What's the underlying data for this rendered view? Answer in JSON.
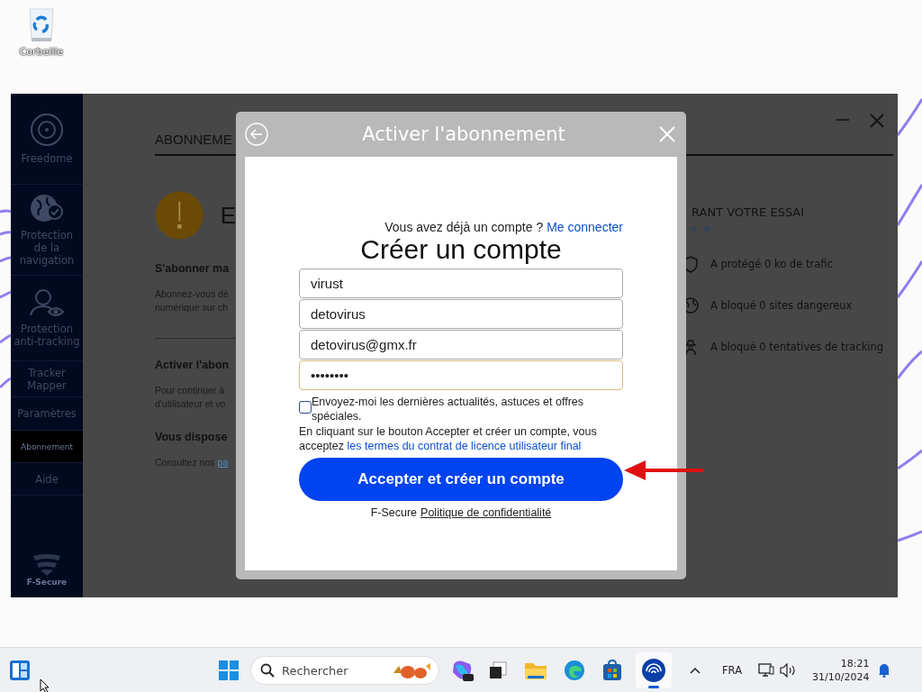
{
  "desktop": {
    "icons": [
      {
        "label": "Corbeille"
      }
    ]
  },
  "app_window": {
    "sidebar": {
      "items": [
        {
          "label": "Freedome",
          "selected": false
        },
        {
          "label": "Protection de la navigation",
          "selected": false
        },
        {
          "label": "Protection anti-tracking",
          "selected": false
        },
        {
          "label": "Tracker Mapper",
          "selected": false
        },
        {
          "label": "Paramètres",
          "selected": false
        },
        {
          "label": "Abonnement",
          "selected": true
        },
        {
          "label": "Aide",
          "selected": false
        }
      ],
      "logo": "F-Secure"
    },
    "main": {
      "heading": "ABONNEME",
      "status_title": "E",
      "sections": [
        {
          "title": "S'abonner ma",
          "lines": [
            "Abonnez-vous dè",
            "numérique sur ch"
          ],
          "divider": true
        },
        {
          "title": "Activer l'abon",
          "lines": [
            "Pour continuer à",
            "d'utilisateur et vo"
          ],
          "divider": false
        },
        {
          "title": "Vous dispose",
          "prefix": "Consultez nos",
          "link": "pa",
          "divider": false
        }
      ]
    },
    "trial_panel": {
      "title": "RANT VOTRE ESSAI",
      "stats": [
        {
          "text": "A protégé 0 ko de trafic"
        },
        {
          "text": "A bloqué 0 sites dangereux"
        },
        {
          "text": "A bloqué 0 tentatives de tracking"
        }
      ]
    }
  },
  "dialog": {
    "title": "Activer l'abonnement",
    "login_prompt": "Vous avez déjà un compte ?",
    "login_link": "Me connecter",
    "heading": "Créer un compte",
    "fields": [
      {
        "value": "virust",
        "focused": false
      },
      {
        "value": "detovirus",
        "focused": false
      },
      {
        "value": "detovirus@gmx.fr",
        "focused": false
      },
      {
        "value": "••••••••",
        "focused": true
      }
    ],
    "newsletter": {
      "label": "Envoyez-moi les dernières actualités, astuces et offres spéciales.",
      "checked": false
    },
    "terms_text": "En cliquant sur le bouton Accepter et créer un compte, vous acceptez ",
    "terms_link": "les termes du contrat de licence utilisateur final",
    "submit": "Accepter et créer un compte",
    "footer_brand": "F-Secure",
    "privacy_link": "Politique de confidentialité"
  },
  "taskbar": {
    "search_placeholder": "Rechercher",
    "language": "FRA",
    "time": "18:21",
    "date": "31/10/2024"
  }
}
